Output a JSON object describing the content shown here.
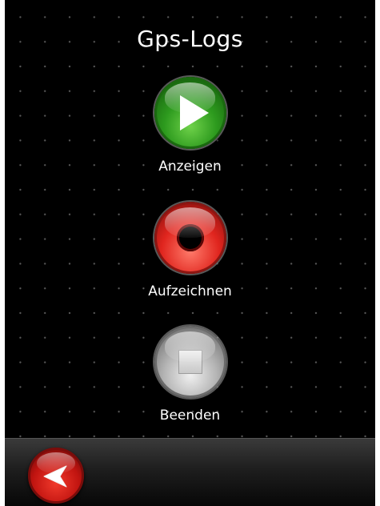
{
  "app": {
    "title": "Gps-Logs"
  },
  "actions": {
    "show": {
      "label": "Anzeigen",
      "icon": "play-icon",
      "color": "#2d9a1e"
    },
    "record": {
      "label": "Aufzeichnen",
      "icon": "record-icon",
      "color": "#e0251e"
    },
    "stop": {
      "label": "Beenden",
      "icon": "stop-icon",
      "color": "#b5b5b5"
    }
  },
  "bottom_bar": {
    "back_icon": "back-arrow-icon",
    "back_color": "#c11410"
  }
}
